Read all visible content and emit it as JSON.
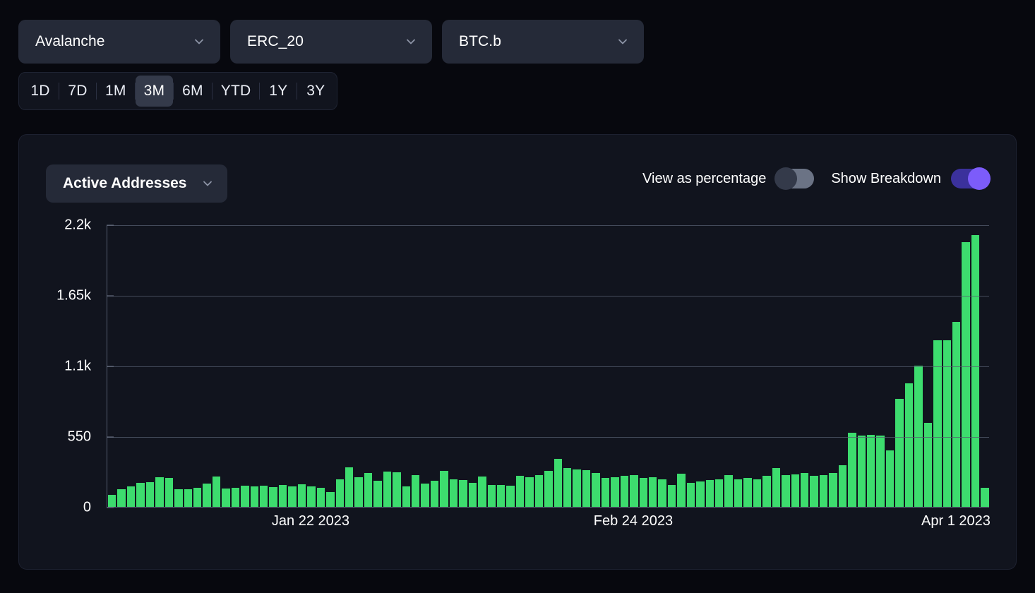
{
  "filters": [
    {
      "name": "chain-select",
      "value": "Avalanche",
      "icon": "chevron-down-icon"
    },
    {
      "name": "standard-select",
      "value": "ERC_20",
      "icon": "chevron-down-icon"
    },
    {
      "name": "token-select",
      "value": "BTC.b",
      "icon": "chevron-down-icon"
    }
  ],
  "range_tabs": {
    "items": [
      "1D",
      "7D",
      "1M",
      "3M",
      "6M",
      "YTD",
      "1Y",
      "3Y"
    ],
    "selected": "3M"
  },
  "card": {
    "metric_select": {
      "value": "Active Addresses",
      "icon": "chevron-down-icon"
    },
    "toggles": [
      {
        "name": "view-as-percentage-toggle",
        "label": "View as percentage",
        "on": false
      },
      {
        "name": "show-breakdown-toggle",
        "label": "Show Breakdown",
        "on": true
      }
    ]
  },
  "colors": {
    "page_bg": "#07080e",
    "card_bg": "#11141e",
    "control_bg": "#252a38",
    "bar": "#3ddc6e",
    "toggle_on_track": "#3b319c",
    "toggle_on_knob": "#7c5cfa",
    "toggle_off_track": "#6b7385",
    "toggle_off_knob": "#343a4a",
    "axis": "#555d70"
  },
  "chart_data": {
    "type": "bar",
    "title": "Active Addresses",
    "xlabel": "",
    "ylabel": "",
    "ylim": [
      0,
      2200
    ],
    "grid": true,
    "legend": false,
    "bar_color": "#3ddc6e",
    "ytick_labels": [
      "0",
      "550",
      "1.1k",
      "1.65k",
      "2.2k"
    ],
    "ytick_values": [
      0,
      550,
      1100,
      1650,
      2200
    ],
    "xtick_labels": [
      "Jan 22 2023",
      "Feb 24 2023",
      "Apr 1 2023"
    ],
    "xtick_indices": [
      21,
      55,
      89
    ],
    "series": [
      {
        "name": "Active Addresses",
        "values": [
          95,
          140,
          160,
          185,
          195,
          230,
          225,
          140,
          140,
          150,
          180,
          235,
          145,
          150,
          165,
          160,
          165,
          155,
          170,
          160,
          175,
          160,
          150,
          115,
          215,
          310,
          230,
          265,
          205,
          275,
          270,
          160,
          245,
          180,
          205,
          280,
          215,
          210,
          185,
          235,
          170,
          170,
          165,
          240,
          230,
          245,
          280,
          375,
          300,
          290,
          285,
          265,
          225,
          230,
          240,
          245,
          225,
          230,
          215,
          170,
          260,
          185,
          200,
          210,
          215,
          250,
          215,
          225,
          215,
          240,
          300,
          250,
          255,
          265,
          240,
          250,
          265,
          325,
          575,
          555,
          560,
          555,
          440,
          840,
          965,
          1100,
          655,
          1300,
          1300,
          1440,
          2060,
          2120,
          150
        ]
      }
    ]
  }
}
